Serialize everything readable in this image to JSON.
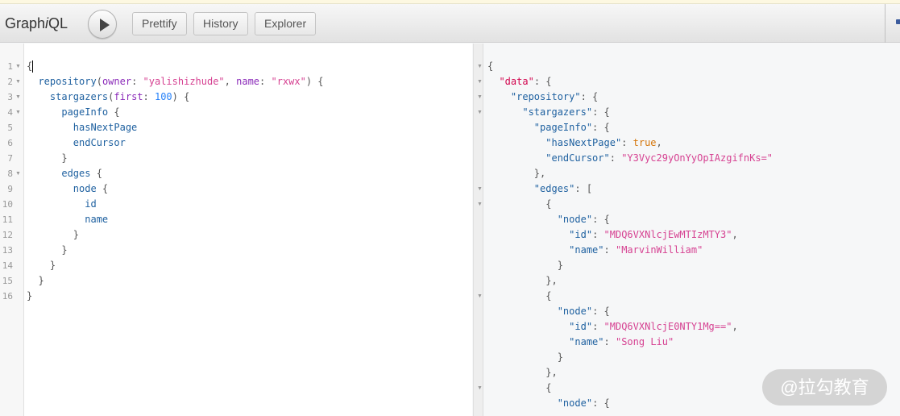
{
  "toolbar": {
    "title_prefix": "Graph",
    "title_italic": "i",
    "title_suffix": "QL",
    "run_label": "Execute query",
    "prettify": "Prettify",
    "history": "History",
    "explorer": "Explorer"
  },
  "query": {
    "lines": [
      {
        "n": "1",
        "fold": true,
        "tokens": [
          [
            "p",
            "{"
          ]
        ]
      },
      {
        "n": "2",
        "fold": true,
        "tokens": [
          [
            "p",
            "  "
          ],
          [
            "field",
            "repository"
          ],
          [
            "p",
            "("
          ],
          [
            "arg",
            "owner"
          ],
          [
            "p",
            ": "
          ],
          [
            "str",
            "\"yalishizhude\""
          ],
          [
            "p",
            ", "
          ],
          [
            "arg",
            "name"
          ],
          [
            "p",
            ": "
          ],
          [
            "str",
            "\"rxwx\""
          ],
          [
            "p",
            ") {"
          ]
        ]
      },
      {
        "n": "3",
        "fold": true,
        "tokens": [
          [
            "p",
            "    "
          ],
          [
            "field",
            "stargazers"
          ],
          [
            "p",
            "("
          ],
          [
            "arg",
            "first"
          ],
          [
            "p",
            ": "
          ],
          [
            "num",
            "100"
          ],
          [
            "p",
            ") {"
          ]
        ]
      },
      {
        "n": "4",
        "fold": true,
        "tokens": [
          [
            "p",
            "      "
          ],
          [
            "field",
            "pageInfo"
          ],
          [
            "p",
            " {"
          ]
        ]
      },
      {
        "n": "5",
        "fold": false,
        "tokens": [
          [
            "p",
            "        "
          ],
          [
            "field",
            "hasNextPage"
          ]
        ]
      },
      {
        "n": "6",
        "fold": false,
        "tokens": [
          [
            "p",
            "        "
          ],
          [
            "field",
            "endCursor"
          ]
        ]
      },
      {
        "n": "7",
        "fold": false,
        "tokens": [
          [
            "p",
            "      }"
          ]
        ]
      },
      {
        "n": "8",
        "fold": true,
        "tokens": [
          [
            "p",
            "      "
          ],
          [
            "field",
            "edges"
          ],
          [
            "p",
            " {"
          ]
        ]
      },
      {
        "n": "9",
        "fold": false,
        "tokens": [
          [
            "p",
            "        "
          ],
          [
            "field",
            "node"
          ],
          [
            "p",
            " {"
          ]
        ]
      },
      {
        "n": "10",
        "fold": false,
        "tokens": [
          [
            "p",
            "          "
          ],
          [
            "field",
            "id"
          ]
        ]
      },
      {
        "n": "11",
        "fold": false,
        "tokens": [
          [
            "p",
            "          "
          ],
          [
            "field",
            "name"
          ]
        ]
      },
      {
        "n": "12",
        "fold": false,
        "tokens": [
          [
            "p",
            "        }"
          ]
        ]
      },
      {
        "n": "13",
        "fold": false,
        "tokens": [
          [
            "p",
            "      }"
          ]
        ]
      },
      {
        "n": "14",
        "fold": false,
        "tokens": [
          [
            "p",
            "    }"
          ]
        ]
      },
      {
        "n": "15",
        "fold": false,
        "tokens": [
          [
            "p",
            "  }"
          ]
        ]
      },
      {
        "n": "16",
        "fold": false,
        "tokens": [
          [
            "p",
            "}"
          ]
        ]
      }
    ]
  },
  "result": {
    "lines": [
      {
        "fold": true,
        "tokens": [
          [
            "p",
            "{"
          ]
        ]
      },
      {
        "fold": true,
        "tokens": [
          [
            "p",
            "  "
          ],
          [
            "dkey",
            "\"data\""
          ],
          [
            "p",
            ": {"
          ]
        ]
      },
      {
        "fold": true,
        "tokens": [
          [
            "p",
            "    "
          ],
          [
            "key",
            "\"repository\""
          ],
          [
            "p",
            ": {"
          ]
        ]
      },
      {
        "fold": true,
        "tokens": [
          [
            "p",
            "      "
          ],
          [
            "key",
            "\"stargazers\""
          ],
          [
            "p",
            ": {"
          ]
        ]
      },
      {
        "fold": false,
        "tokens": [
          [
            "p",
            "        "
          ],
          [
            "key",
            "\"pageInfo\""
          ],
          [
            "p",
            ": {"
          ]
        ]
      },
      {
        "fold": false,
        "tokens": [
          [
            "p",
            "          "
          ],
          [
            "key",
            "\"hasNextPage\""
          ],
          [
            "p",
            ": "
          ],
          [
            "bool",
            "true"
          ],
          [
            "p",
            ","
          ]
        ]
      },
      {
        "fold": false,
        "tokens": [
          [
            "p",
            "          "
          ],
          [
            "key",
            "\"endCursor\""
          ],
          [
            "p",
            ": "
          ],
          [
            "str",
            "\"Y3Vyc29yOnYyOpIAzgifnKs=\""
          ]
        ]
      },
      {
        "fold": false,
        "tokens": [
          [
            "p",
            "        },"
          ]
        ]
      },
      {
        "fold": true,
        "tokens": [
          [
            "p",
            "        "
          ],
          [
            "key",
            "\"edges\""
          ],
          [
            "p",
            ": ["
          ]
        ]
      },
      {
        "fold": true,
        "tokens": [
          [
            "p",
            "          {"
          ]
        ]
      },
      {
        "fold": false,
        "tokens": [
          [
            "p",
            "            "
          ],
          [
            "key",
            "\"node\""
          ],
          [
            "p",
            ": {"
          ]
        ]
      },
      {
        "fold": false,
        "tokens": [
          [
            "p",
            "              "
          ],
          [
            "key",
            "\"id\""
          ],
          [
            "p",
            ": "
          ],
          [
            "str",
            "\"MDQ6VXNlcjEwMTIzMTY3\""
          ],
          [
            "p",
            ","
          ]
        ]
      },
      {
        "fold": false,
        "tokens": [
          [
            "p",
            "              "
          ],
          [
            "key",
            "\"name\""
          ],
          [
            "p",
            ": "
          ],
          [
            "str",
            "\"MarvinWilliam\""
          ]
        ]
      },
      {
        "fold": false,
        "tokens": [
          [
            "p",
            "            }"
          ]
        ]
      },
      {
        "fold": false,
        "tokens": [
          [
            "p",
            "          },"
          ]
        ]
      },
      {
        "fold": true,
        "tokens": [
          [
            "p",
            "          {"
          ]
        ]
      },
      {
        "fold": false,
        "tokens": [
          [
            "p",
            "            "
          ],
          [
            "key",
            "\"node\""
          ],
          [
            "p",
            ": {"
          ]
        ]
      },
      {
        "fold": false,
        "tokens": [
          [
            "p",
            "              "
          ],
          [
            "key",
            "\"id\""
          ],
          [
            "p",
            ": "
          ],
          [
            "str",
            "\"MDQ6VXNlcjE0NTY1Mg==\""
          ],
          [
            "p",
            ","
          ]
        ]
      },
      {
        "fold": false,
        "tokens": [
          [
            "p",
            "              "
          ],
          [
            "key",
            "\"name\""
          ],
          [
            "p",
            ": "
          ],
          [
            "str",
            "\"Song Liu\""
          ]
        ]
      },
      {
        "fold": false,
        "tokens": [
          [
            "p",
            "            }"
          ]
        ]
      },
      {
        "fold": false,
        "tokens": [
          [
            "p",
            "          },"
          ]
        ]
      },
      {
        "fold": true,
        "tokens": [
          [
            "p",
            "          {"
          ]
        ]
      },
      {
        "fold": false,
        "tokens": [
          [
            "p",
            "            "
          ],
          [
            "key",
            "\"node\""
          ],
          [
            "p",
            ": {"
          ]
        ]
      }
    ]
  },
  "watermark": "@拉勾教育"
}
